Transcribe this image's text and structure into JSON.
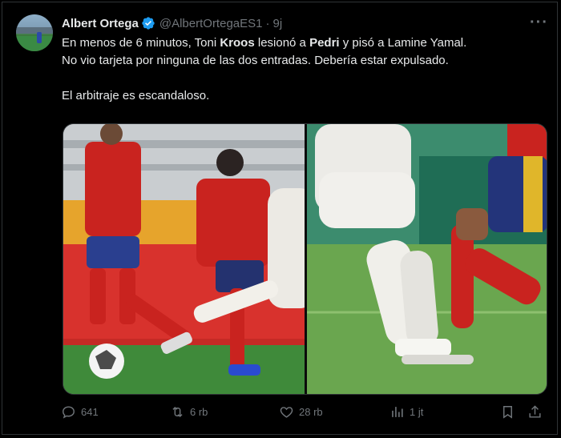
{
  "colors": {
    "background": "#000000",
    "text": "#e7e9ea",
    "muted": "#71767b",
    "verified": "#1d9bf0",
    "border": "#2f3336"
  },
  "author": {
    "name": "Albert Ortega",
    "handle": "@AlbertOrtegaES1",
    "separator": "·",
    "time": "9j",
    "verified_icon": "verified-badge-icon"
  },
  "post": {
    "line1_a": "En menos de 6 minutos, Toni ",
    "line1_kroos": "Kroos",
    "line1_b": " lesionó a ",
    "line1_pedri": "Pedri",
    "line1_c": " y pisó a Lamine Yamal.",
    "line2": "No vio tarjeta por ninguna de las dos entradas. Debería estar expulsado.",
    "line3": "El arbitraje es escandaloso."
  },
  "actions": {
    "reply": {
      "icon": "reply-icon",
      "count": "641"
    },
    "repost": {
      "icon": "repost-icon",
      "count": "6 rb"
    },
    "like": {
      "icon": "heart-icon",
      "count": "28 rb"
    },
    "views": {
      "icon": "views-icon",
      "count": "1 jt"
    },
    "bookmark": {
      "icon": "bookmark-icon"
    },
    "share": {
      "icon": "share-icon"
    }
  }
}
